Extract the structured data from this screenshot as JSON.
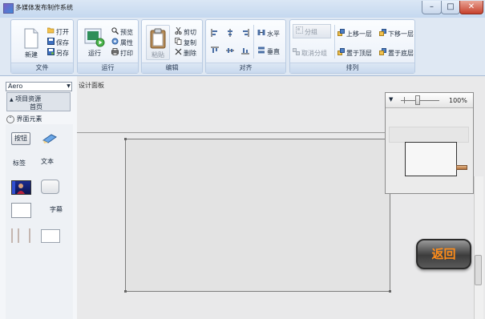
{
  "window": {
    "title": "多媒体发布制作系统",
    "minimize": "–",
    "maximize": "□",
    "close": "✕"
  },
  "ribbon": {
    "file": {
      "label": "文件",
      "new": "新建",
      "open": "打开",
      "save": "保存",
      "save_as": "另存"
    },
    "run": {
      "label": "运行",
      "run": "运行",
      "preview": "预览",
      "properties": "属性",
      "print": "打印"
    },
    "edit": {
      "label": "编辑",
      "paste": "粘贴",
      "cut": "剪切",
      "copy": "复制",
      "delete": "删除"
    },
    "align": {
      "label": "对齐",
      "horizontal": "水平",
      "vertical": "垂直"
    },
    "arrange": {
      "label": "排列",
      "group": "分组",
      "ungroup": "取消分组",
      "move_up": "上移一层",
      "move_down": "下移一层",
      "to_top": "置于顶层",
      "to_bottom": "置于底层"
    }
  },
  "left_panel": {
    "theme": "Aero",
    "tree": {
      "root": "项目资源",
      "child": "首页"
    },
    "elements_header": "界面元素",
    "palette": {
      "button": "按钮",
      "text": "文本",
      "label": "标签",
      "marquee": "字幕"
    }
  },
  "design": {
    "label": "设计面板",
    "zoom": "100%",
    "return_button": "返回"
  },
  "colors": {
    "accent": "#ff8d1a",
    "ribbon_bg": "#dfe8f3",
    "close_red": "#c7412c"
  }
}
